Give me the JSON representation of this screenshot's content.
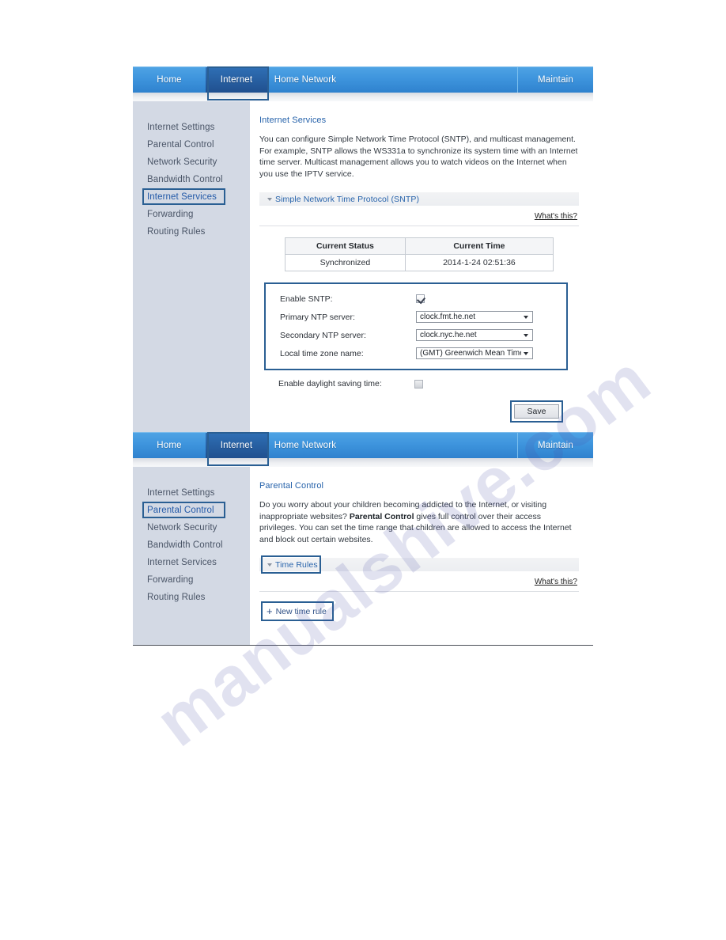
{
  "watermark": {
    "text": "manualshive.com"
  },
  "nav": {
    "tabs": [
      {
        "label": "Home",
        "active": false
      },
      {
        "label": "Internet",
        "active": true
      },
      {
        "label": "Home Network",
        "active": false
      },
      {
        "label": "Maintain",
        "active": false
      }
    ]
  },
  "panel1": {
    "sidebar": [
      {
        "label": "Internet Settings",
        "active": false
      },
      {
        "label": "Parental Control",
        "active": false
      },
      {
        "label": "Network Security",
        "active": false
      },
      {
        "label": "Bandwidth Control",
        "active": false
      },
      {
        "label": "Internet Services",
        "active": true
      },
      {
        "label": "Forwarding",
        "active": false
      },
      {
        "label": "Routing Rules",
        "active": false
      }
    ],
    "title": "Internet Services",
    "description": "You can configure Simple Network Time Protocol (SNTP), and multicast management. For example, SNTP allows the WS331a to synchronize its system time with an Internet time server. Multicast management allows you to watch videos on the Internet when you use the IPTV service.",
    "section_label": "Simple Network Time Protocol (SNTP)",
    "whats_this": "What's this?",
    "table": {
      "headers": [
        "Current Status",
        "Current Time"
      ],
      "row": [
        "Synchronized",
        "2014-1-24 02:51:36"
      ]
    },
    "form": {
      "enable_sntp_label": "Enable SNTP:",
      "enable_sntp_checked": true,
      "primary_ntp_label": "Primary NTP server:",
      "primary_ntp_value": "clock.fmt.he.net",
      "secondary_ntp_label": "Secondary NTP server:",
      "secondary_ntp_value": "clock.nyc.he.net",
      "timezone_label": "Local time zone name:",
      "timezone_value": "(GMT) Greenwich Mean Time: Dut",
      "dst_label": "Enable daylight saving time:",
      "dst_checked": false
    },
    "save_label": "Save"
  },
  "panel2": {
    "sidebar": [
      {
        "label": "Internet Settings",
        "active": false
      },
      {
        "label": "Parental Control",
        "active": true
      },
      {
        "label": "Network Security",
        "active": false
      },
      {
        "label": "Bandwidth Control",
        "active": false
      },
      {
        "label": "Internet Services",
        "active": false
      },
      {
        "label": "Forwarding",
        "active": false
      },
      {
        "label": "Routing Rules",
        "active": false
      }
    ],
    "title": "Parental Control",
    "desc_line1": "Do you worry about your children becoming addicted to the Internet, or visiting inappropriate websites?",
    "desc_bold": "Parental Control",
    "desc_line2": " gives full control over their access privileges. You can set the time range that children are allowed to access the Internet and block out certain websites.",
    "section_label": "Time Rules",
    "whats_this": "What's this?",
    "new_rule_label": "New time rule",
    "new_rule_plus": "+"
  }
}
